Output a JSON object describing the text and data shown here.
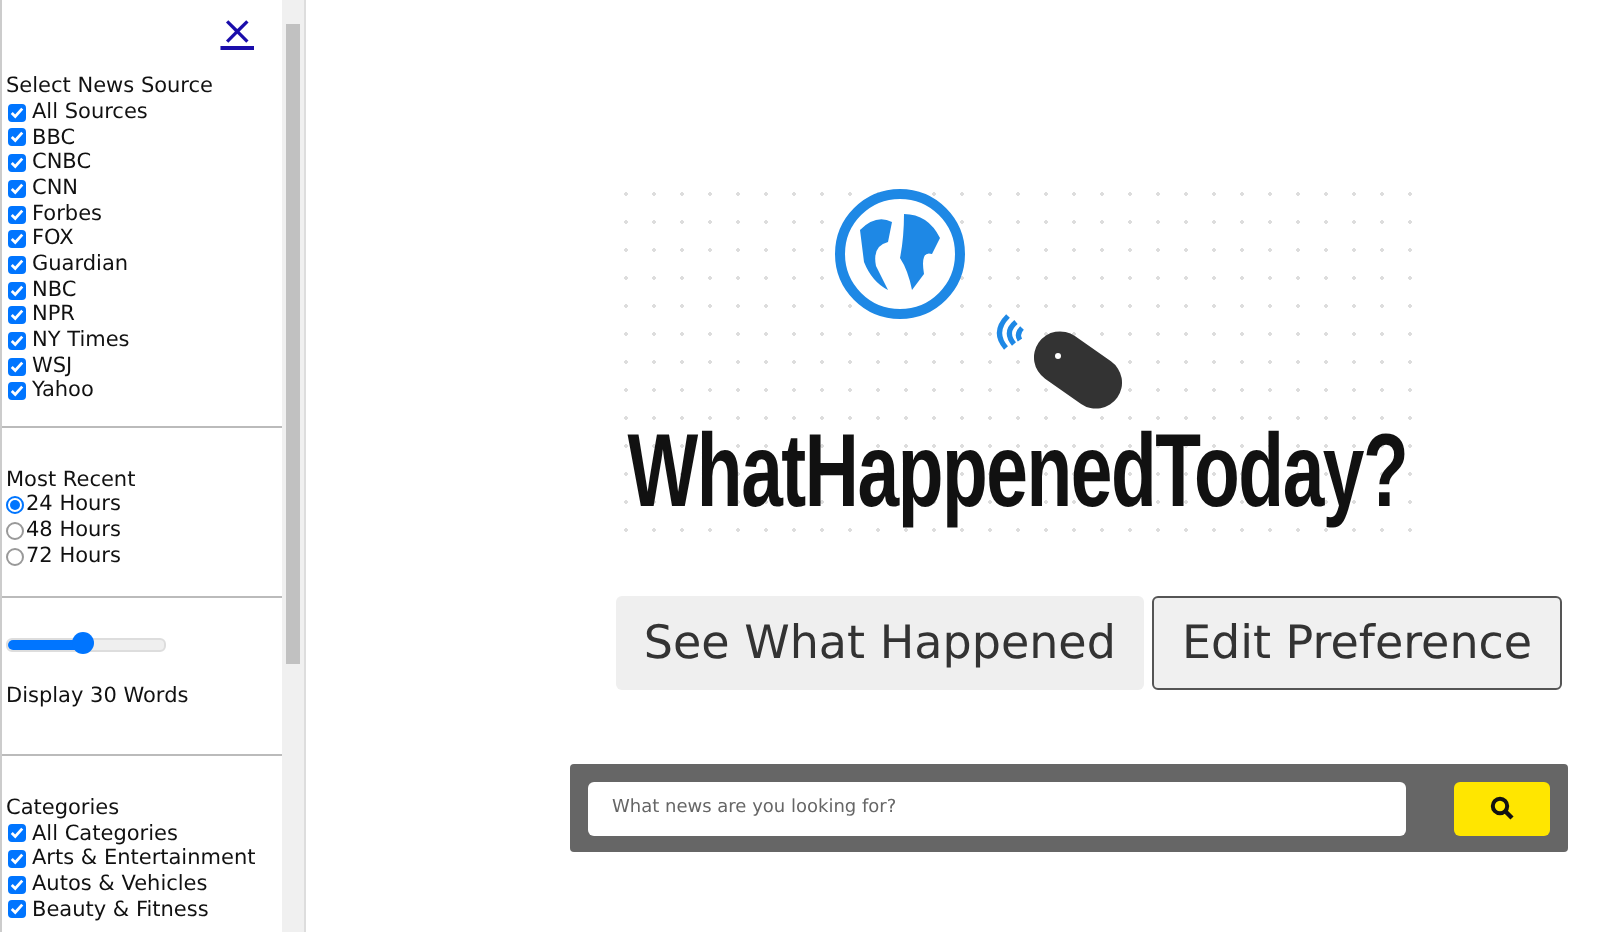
{
  "sidebar": {
    "close": "×",
    "sources": {
      "title": "Select News Source",
      "items": [
        {
          "label": "All Sources",
          "checked": true
        },
        {
          "label": "BBC",
          "checked": true
        },
        {
          "label": "CNBC",
          "checked": true
        },
        {
          "label": "CNN",
          "checked": true
        },
        {
          "label": "Forbes",
          "checked": true
        },
        {
          "label": "FOX",
          "checked": true
        },
        {
          "label": "Guardian",
          "checked": true
        },
        {
          "label": "NBC",
          "checked": true
        },
        {
          "label": "NPR",
          "checked": true
        },
        {
          "label": "NY Times",
          "checked": true
        },
        {
          "label": "WSJ",
          "checked": true
        },
        {
          "label": "Yahoo",
          "checked": true
        }
      ]
    },
    "recent": {
      "title": "Most Recent",
      "options": [
        {
          "label": "24 Hours",
          "selected": true
        },
        {
          "label": "48 Hours",
          "selected": false
        },
        {
          "label": "72 Hours",
          "selected": false
        }
      ]
    },
    "words": {
      "level": 0.48,
      "label": "Display 30 Words"
    },
    "categories": {
      "title": "Categories",
      "items": [
        {
          "label": "All Categories",
          "checked": true
        },
        {
          "label": "Arts & Entertainment",
          "checked": true
        },
        {
          "label": "Autos & Vehicles",
          "checked": true
        },
        {
          "label": "Beauty & Fitness",
          "checked": true
        }
      ]
    }
  },
  "logo": {
    "text": "WhatHappenedToday?"
  },
  "buttons": [
    {
      "label": "See What Happened",
      "kind": "filled"
    },
    {
      "label": "Edit Preference",
      "kind": "outlined"
    }
  ],
  "search": {
    "placeholder": "What news are you looking for?"
  }
}
